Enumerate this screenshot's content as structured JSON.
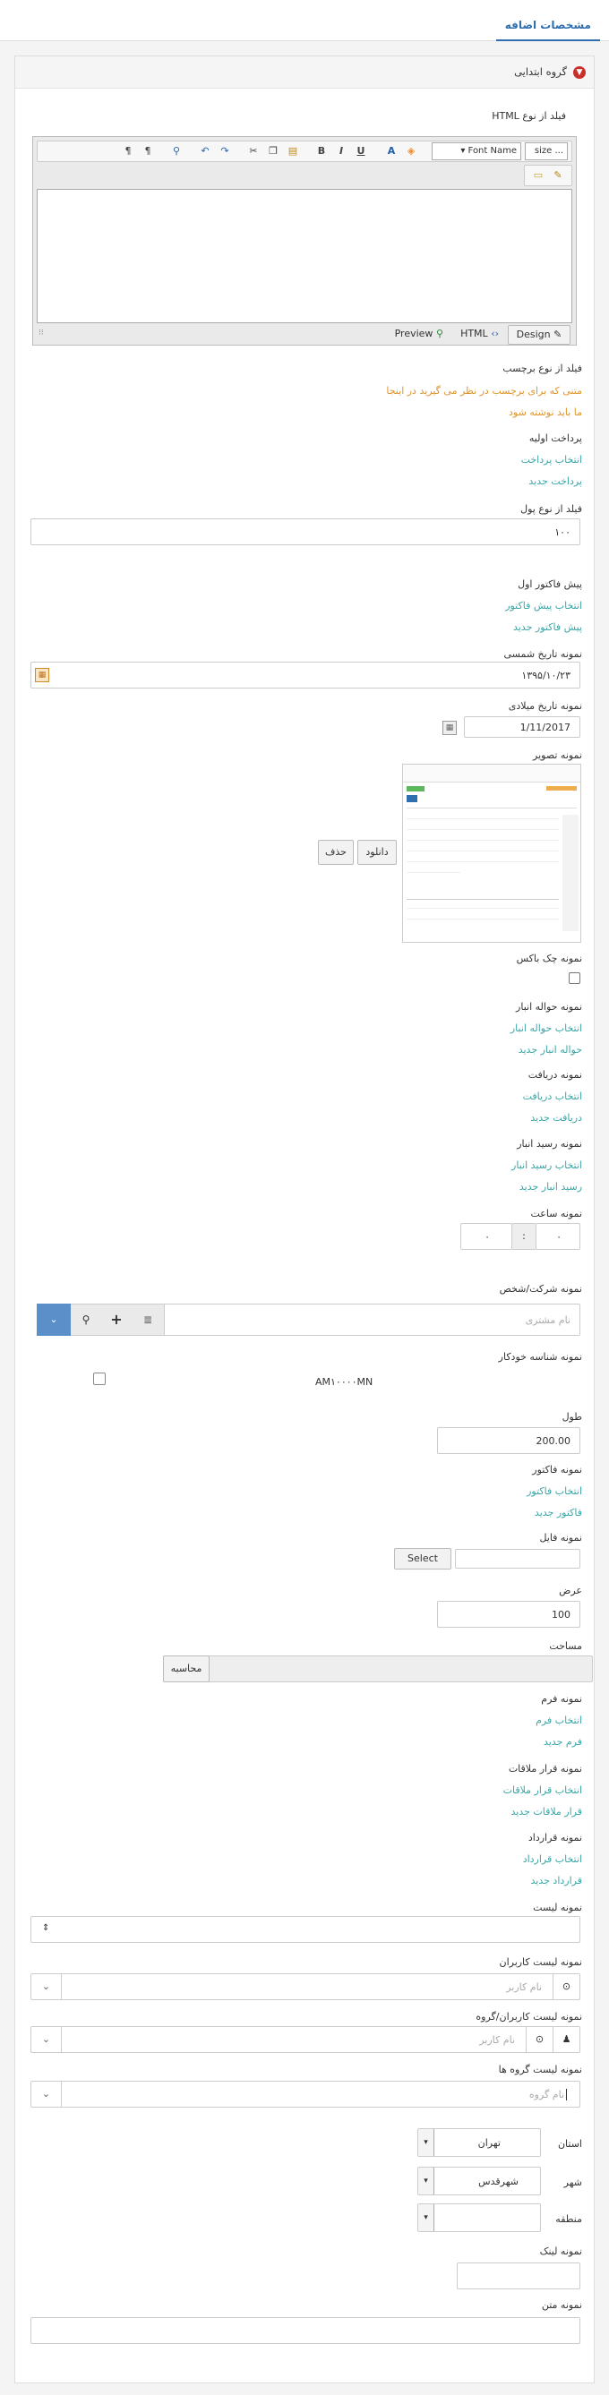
{
  "tab": {
    "label": "مشخصات اضافه"
  },
  "panel": {
    "title": "گروه ابتدایی",
    "collapse_icon": "chevron-down-icon"
  },
  "html_field": {
    "label": "فیلد از نوع HTML",
    "font_size": "... size",
    "font_name": "Font Name",
    "mode_design": "Design",
    "mode_html": "HTML",
    "mode_preview": "Preview"
  },
  "label_field": {
    "label": "فیلد از نوع برچسب",
    "line1": "متنی که برای برچسب در نظر می گیرید در اینجا",
    "line2": "ما باید نوشته شود"
  },
  "prepayment": {
    "label": "پرداخت اولیه",
    "select": "انتخاب پرداخت",
    "new": "پرداخت جدید"
  },
  "money": {
    "label": "فیلد از نوع پول",
    "value": "۱۰۰"
  },
  "proforma": {
    "label": "پیش فاکتور اول",
    "select": "انتخاب پیش فاکتور",
    "new": "پیش فاکتور جدید"
  },
  "shamsi": {
    "label": "نمونه تاریخ شمسی",
    "value": "۱۳۹۵/۱۰/۲۳"
  },
  "gregorian": {
    "label": "نمونه تاریخ میلادی",
    "value": "1/11/2017"
  },
  "image": {
    "label": "نمونه تصویر",
    "download": "دانلود",
    "delete": "حذف"
  },
  "checkbox": {
    "label": "نمونه چک باکس"
  },
  "stock_transfer": {
    "label": "نمونه حواله انبار",
    "select": "انتخاب حواله انبار",
    "new": "حواله انبار جدید"
  },
  "receipt": {
    "label": "نمونه دریافت",
    "select": "انتخاب دریافت",
    "new": "دریافت جدید"
  },
  "stock_receipt": {
    "label": "نمونه رسید انبار",
    "select": "انتخاب رسید انبار",
    "new": "رسید انبار جدید"
  },
  "time": {
    "label": "نمونه ساعت",
    "hour": "۰",
    "minute": "۰",
    "sep": ":"
  },
  "company": {
    "label": "نمونه شرکت/شخص",
    "placeholder": "نام مشتری"
  },
  "auto_id": {
    "label": "نمونه شناسه خودکار",
    "value": "AM۱۰۰۰۰MN"
  },
  "length": {
    "label": "طول",
    "value": "200.00"
  },
  "invoice": {
    "label": "نمونه فاکتور",
    "select": "انتخاب فاکتور",
    "new": "فاکتور جدید"
  },
  "file": {
    "label": "نمونه فایل",
    "button": "Select"
  },
  "width": {
    "label": "عرض",
    "value": "100"
  },
  "area": {
    "label": "مساحت",
    "button": "محاسبه"
  },
  "form": {
    "label": "نمونه فرم",
    "select": "انتخاب فرم",
    "new": "فرم جدید"
  },
  "session": {
    "label": "نمونه قرار ملاقات",
    "select": "انتخاب قرار ملاقات",
    "new": "قرار ملاقات جدید"
  },
  "contract": {
    "label": "نمونه قرارداد",
    "select": "انتخاب قرارداد",
    "new": "قرارداد جدید"
  },
  "list": {
    "label": "نمونه لیست"
  },
  "user_list": {
    "label": "نمونه لیست کاربران",
    "placeholder": "نام کاربر"
  },
  "user_group_list": {
    "label": "نمونه لیست کاربران/گروه",
    "placeholder": "نام کاربر"
  },
  "group_list": {
    "label": "نمونه لیست گروه ها",
    "placeholder": "نام گروه"
  },
  "province": {
    "label": "استان",
    "value": "تهران"
  },
  "city": {
    "label": "شهر",
    "value": "شهرقدس"
  },
  "region": {
    "label": "منطقه",
    "value": ""
  },
  "link": {
    "label": "نمونه لینک",
    "value": ""
  },
  "text": {
    "label": "نمونه متن",
    "value": ""
  }
}
